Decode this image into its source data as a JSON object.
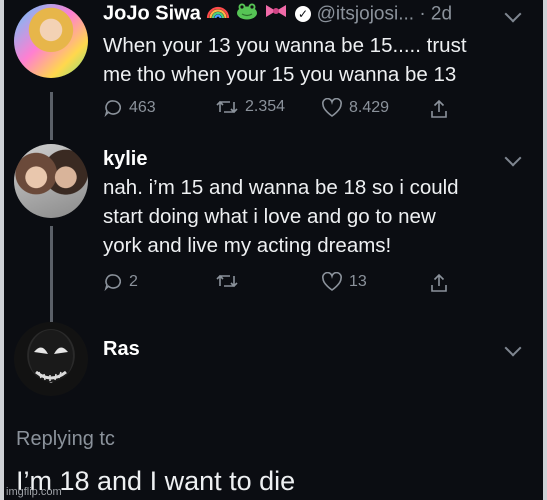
{
  "tweets": [
    {
      "name": "JoJo Siwa",
      "handle": "@itsjojosi... · 2d",
      "text": "When your 13 you wanna be 15..... trust\nme tho when your 15 you wanna be 13",
      "stats": {
        "replies": "463",
        "retweets": "2.354",
        "likes": "8.429"
      }
    },
    {
      "name": "kylie",
      "text": "nah. i’m 15 and wanna be 18 so i could\nstart doing what i love and go to new\nyork and live my acting dreams!",
      "stats": {
        "replies": "2",
        "retweets": "",
        "likes": "13"
      }
    },
    {
      "name": "Ras"
    }
  ],
  "reply": {
    "label": "Replying tc",
    "text": "I’m 18 and I want to die"
  },
  "watermark": "imgflip.com",
  "icons": [
    "rainbow-icon",
    "frog-icon",
    "bow-icon",
    "verified-icon",
    "reply-icon",
    "retweet-icon",
    "like-icon",
    "share-icon",
    "chevron-down-icon"
  ]
}
